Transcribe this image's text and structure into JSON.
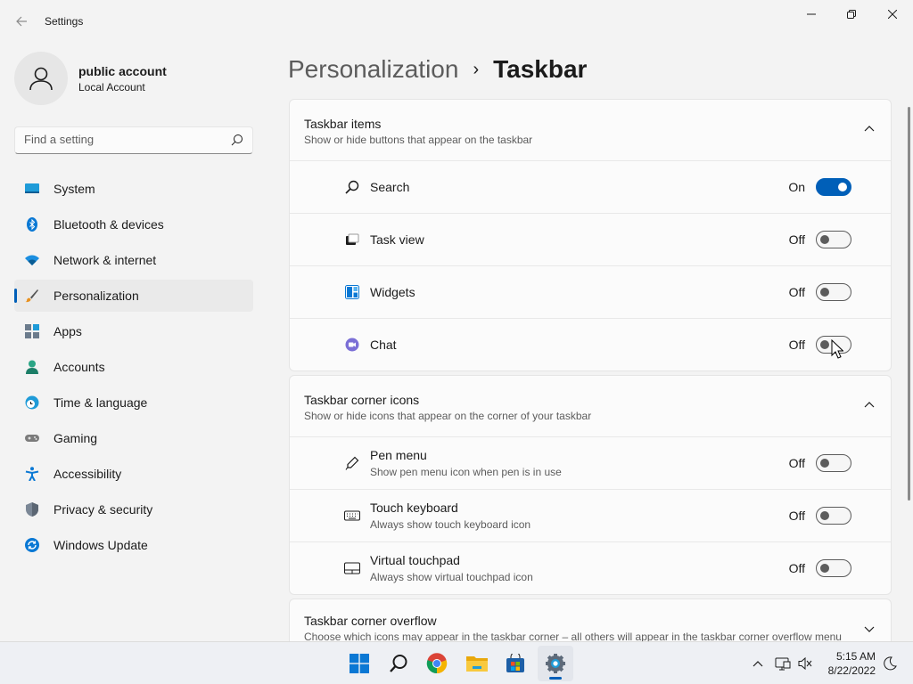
{
  "window": {
    "title": "Settings"
  },
  "profile": {
    "name": "public account",
    "type": "Local Account"
  },
  "search": {
    "placeholder": "Find a setting"
  },
  "sidebar": {
    "items": [
      {
        "label": "System",
        "icon": "system-icon",
        "active": false
      },
      {
        "label": "Bluetooth & devices",
        "icon": "bluetooth-icon",
        "active": false
      },
      {
        "label": "Network & internet",
        "icon": "wifi-icon",
        "active": false
      },
      {
        "label": "Personalization",
        "icon": "brush-icon",
        "active": true
      },
      {
        "label": "Apps",
        "icon": "apps-icon",
        "active": false
      },
      {
        "label": "Accounts",
        "icon": "accounts-icon",
        "active": false
      },
      {
        "label": "Time & language",
        "icon": "clock-globe-icon",
        "active": false
      },
      {
        "label": "Gaming",
        "icon": "gamepad-icon",
        "active": false
      },
      {
        "label": "Accessibility",
        "icon": "accessibility-icon",
        "active": false
      },
      {
        "label": "Privacy & security",
        "icon": "shield-icon",
        "active": false
      },
      {
        "label": "Windows Update",
        "icon": "update-icon",
        "active": false
      }
    ]
  },
  "breadcrumb": {
    "parent": "Personalization",
    "separator": "›",
    "current": "Taskbar"
  },
  "sections": [
    {
      "title": "Taskbar items",
      "subtitle": "Show or hide buttons that appear on the taskbar",
      "expanded": true,
      "rows": [
        {
          "label": "Search",
          "state": "On",
          "on": true,
          "icon": "search-icon"
        },
        {
          "label": "Task view",
          "state": "Off",
          "on": false,
          "icon": "task-view-icon"
        },
        {
          "label": "Widgets",
          "state": "Off",
          "on": false,
          "icon": "widgets-icon"
        },
        {
          "label": "Chat",
          "state": "Off",
          "on": false,
          "icon": "chat-icon"
        }
      ]
    },
    {
      "title": "Taskbar corner icons",
      "subtitle": "Show or hide icons that appear on the corner of your taskbar",
      "expanded": true,
      "rows": [
        {
          "label": "Pen menu",
          "sub": "Show pen menu icon when pen is in use",
          "state": "Off",
          "on": false,
          "icon": "pen-icon"
        },
        {
          "label": "Touch keyboard",
          "sub": "Always show touch keyboard icon",
          "state": "Off",
          "on": false,
          "icon": "keyboard-icon"
        },
        {
          "label": "Virtual touchpad",
          "sub": "Always show virtual touchpad icon",
          "state": "Off",
          "on": false,
          "icon": "touchpad-icon"
        }
      ]
    },
    {
      "title": "Taskbar corner overflow",
      "subtitle": "Choose which icons may appear in the taskbar corner – all others will appear in the taskbar corner overflow menu",
      "expanded": false
    }
  ],
  "taskbar": {
    "apps": [
      "start-icon",
      "search-icon",
      "chrome-icon",
      "file-explorer-icon",
      "store-icon",
      "settings-icon"
    ],
    "clock": {
      "time": "5:15 AM",
      "date": "8/22/2022"
    }
  },
  "colors": {
    "accent": "#005fb8",
    "background": "#f3f3f3",
    "card": "#fbfbfb"
  }
}
